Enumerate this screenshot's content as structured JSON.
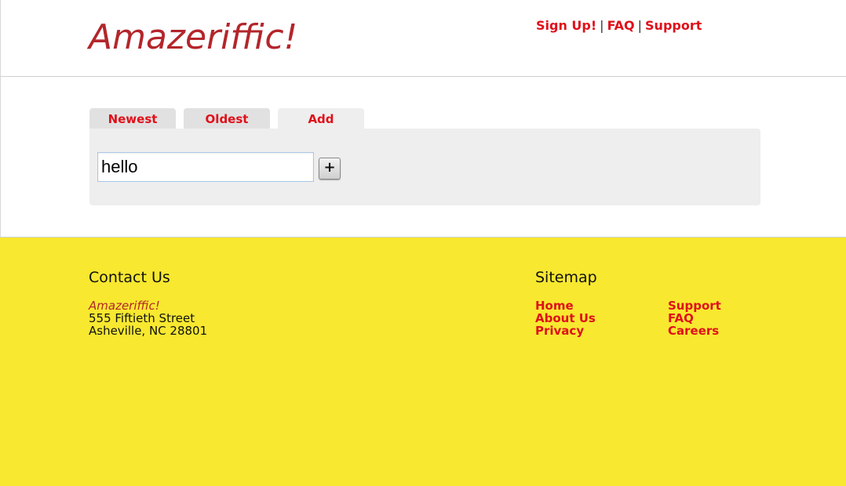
{
  "header": {
    "logo": "Amazeriffic!",
    "nav": {
      "signup": "Sign Up!",
      "faq": "FAQ",
      "support": "Support",
      "separator": "|"
    }
  },
  "tabs": [
    {
      "label": "Newest",
      "active": false
    },
    {
      "label": "Oldest",
      "active": false
    },
    {
      "label": "Add",
      "active": true
    }
  ],
  "add_panel": {
    "input_value": "hello",
    "add_button_label": "+"
  },
  "footer": {
    "contact": {
      "title": "Contact Us",
      "brand": "Amazeriffic!",
      "street": "555 Fiftieth Street",
      "city": "Asheville, NC 28801"
    },
    "sitemap": {
      "title": "Sitemap",
      "col1": [
        "Home",
        "About Us",
        "Privacy"
      ],
      "col2": [
        "Support",
        "FAQ",
        "Careers"
      ]
    }
  },
  "colors": {
    "link_red": "#e0101a",
    "logo_red": "#b3262b",
    "footer_yellow": "#f8e830",
    "panel_gray": "#eeeeee"
  }
}
